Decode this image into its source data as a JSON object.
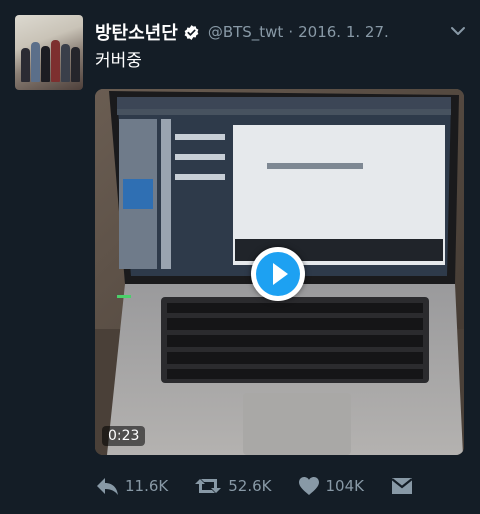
{
  "tweet": {
    "author_name": "방탄소년단",
    "handle": "@BTS_twt",
    "separator": "·",
    "date": "2016. 1. 27.",
    "text": "커버중"
  },
  "video": {
    "duration": "0:23",
    "play_icon": "play-icon"
  },
  "actions": {
    "reply_count": "11.6K",
    "retweet_count": "52.6K",
    "like_count": "104K"
  },
  "icons": [
    "verified-badge-icon",
    "chevron-down-icon",
    "reply-icon",
    "retweet-icon",
    "heart-icon",
    "direct-message-icon",
    "play-icon"
  ],
  "colors": {
    "background": "#141d26",
    "secondary_text": "#8899a6",
    "accent": "#1da1f2"
  }
}
